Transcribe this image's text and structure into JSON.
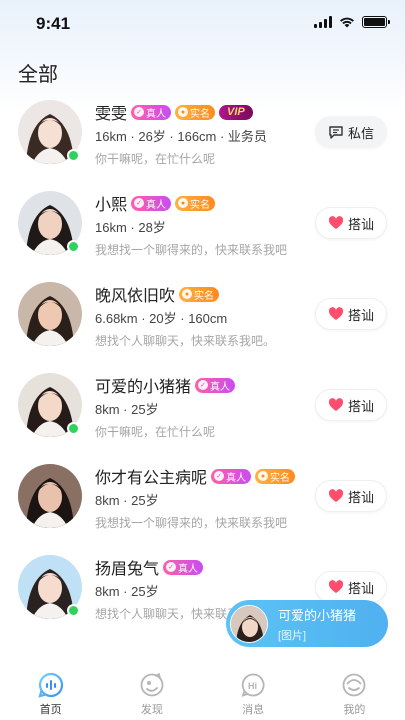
{
  "status_bar": {
    "time": "9:41"
  },
  "page_title": "全部",
  "badges": {
    "real": "真人",
    "verified": "实名",
    "vip": "VIP"
  },
  "users": [
    {
      "name": "雯雯",
      "online": true,
      "real": true,
      "verified": true,
      "vip": true,
      "details": "16km · 26岁 · 166cm · 业务员",
      "signature": "你干嘛呢，在忙什么呢",
      "action": "私信",
      "action_type": "message"
    },
    {
      "name": "小熙",
      "online": true,
      "real": true,
      "verified": true,
      "vip": false,
      "details": "16km · 28岁",
      "signature": "我想找一个聊得来的，快来联系我吧",
      "action": "搭讪",
      "action_type": "greet"
    },
    {
      "name": "晚风依旧吹",
      "online": false,
      "real": false,
      "verified": true,
      "vip": false,
      "details": "6.68km · 20岁 · 160cm",
      "signature": "想找个人聊聊天，快来联系我吧。",
      "action": "搭讪",
      "action_type": "greet"
    },
    {
      "name": "可爱的小猪猪",
      "online": true,
      "real": true,
      "verified": false,
      "vip": false,
      "details": "8km · 25岁",
      "signature": "你干嘛呢，在忙什么呢",
      "action": "搭讪",
      "action_type": "greet"
    },
    {
      "name": "你才有公主病呢",
      "online": false,
      "real": true,
      "verified": true,
      "vip": false,
      "details": "8km · 25岁",
      "signature": "我想找一个聊得来的，快来联系我吧",
      "action": "搭讪",
      "action_type": "greet"
    },
    {
      "name": "扬眉兔气",
      "online": true,
      "real": true,
      "verified": false,
      "vip": false,
      "details": "8km · 25岁",
      "signature": "想找个人聊聊天，快来联系我吧。",
      "action": "搭讪",
      "action_type": "greet"
    }
  ],
  "toast": {
    "title": "可爱的小猪猪",
    "subtitle": "[图片]"
  },
  "tabs": [
    {
      "label": "首页",
      "icon": "home-voice-icon",
      "active": true
    },
    {
      "label": "发现",
      "icon": "discover-icon",
      "active": false
    },
    {
      "label": "消息",
      "icon": "message-hi-icon",
      "active": false
    },
    {
      "label": "我的",
      "icon": "profile-icon",
      "active": false
    }
  ],
  "colors": {
    "accent": "#4fb1f0",
    "online": "#2fd35b",
    "heart": "#ff4d6d"
  }
}
